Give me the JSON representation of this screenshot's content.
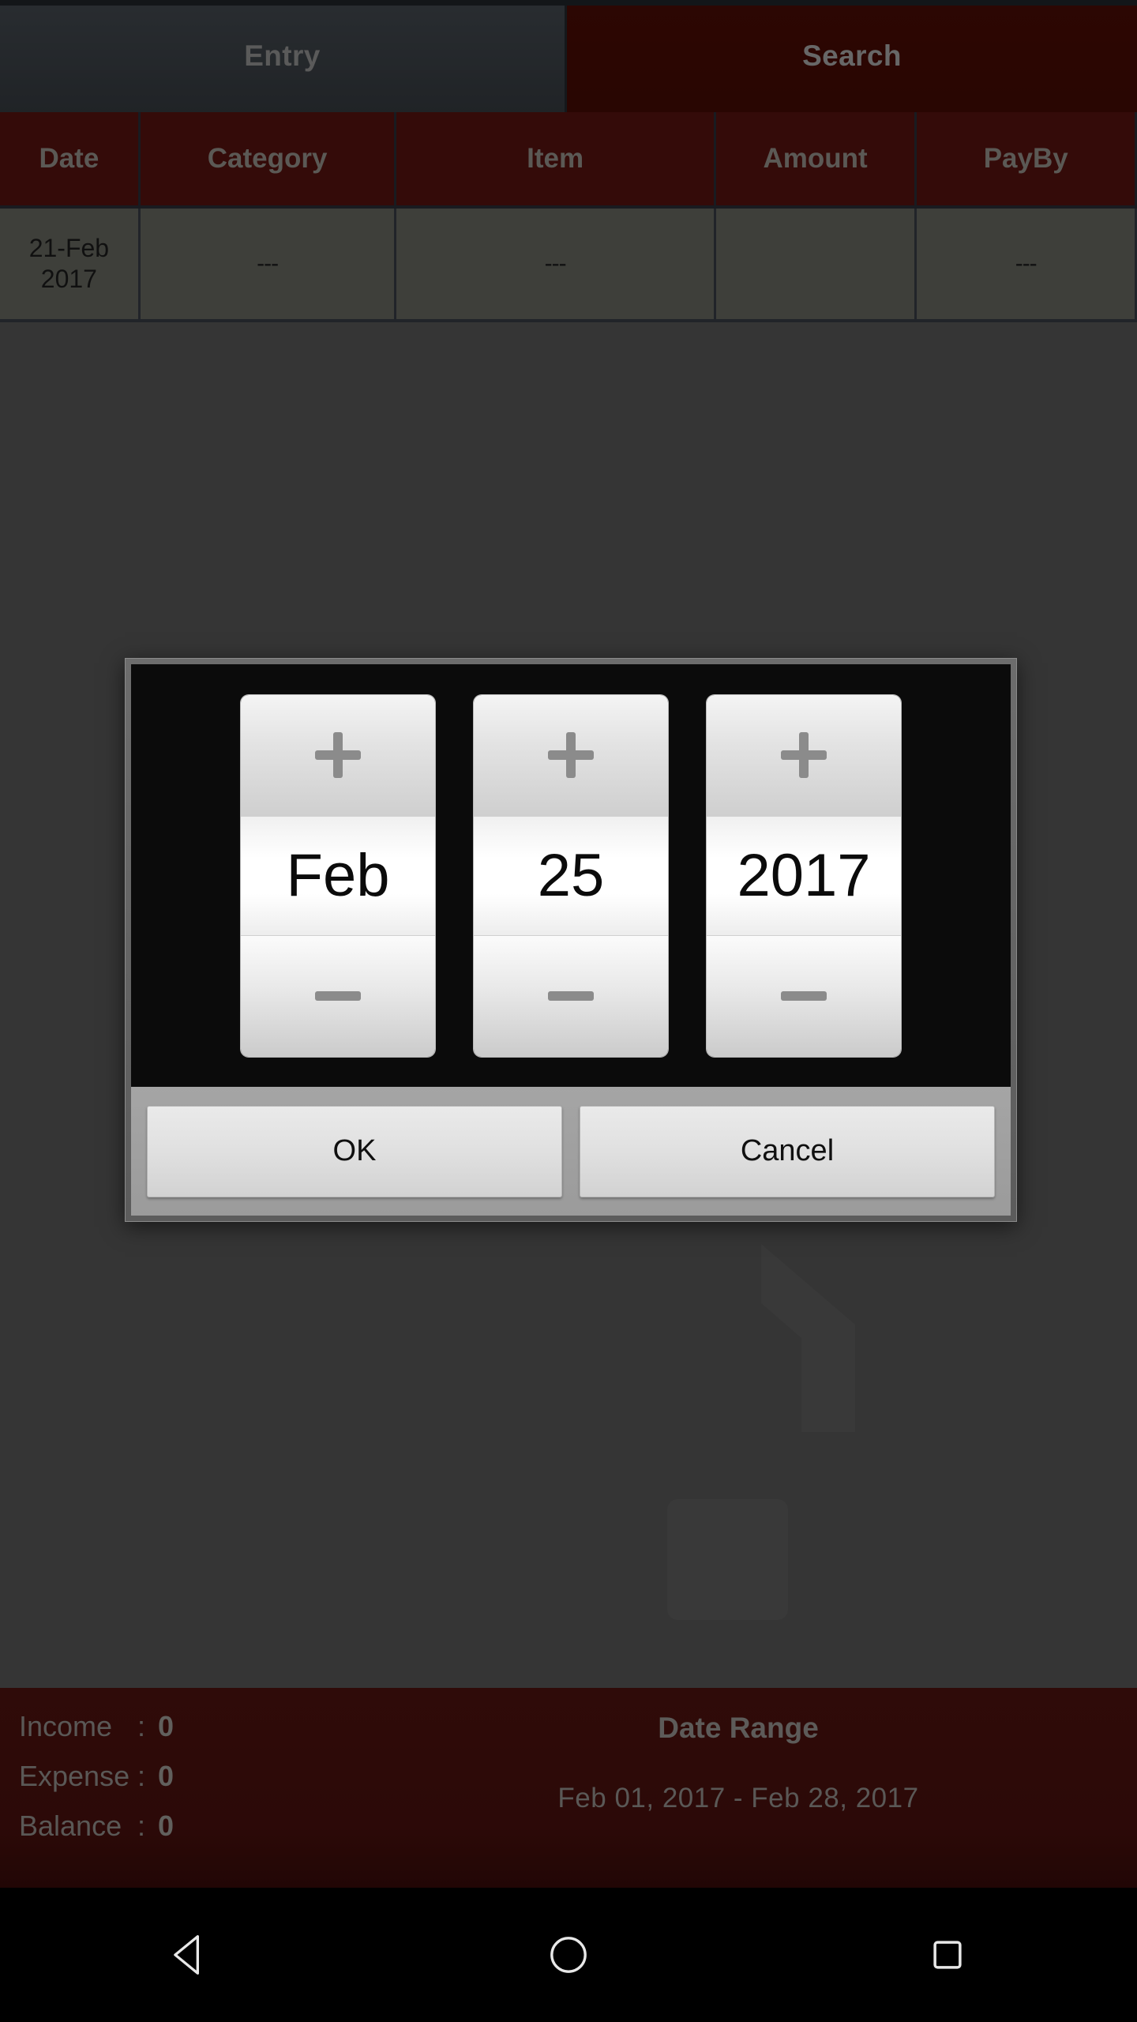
{
  "tabs": [
    {
      "id": "entry",
      "label": "Entry",
      "selected": true
    },
    {
      "id": "search",
      "label": "Search",
      "selected": false
    }
  ],
  "table": {
    "columns": [
      "Date",
      "Category",
      "Item",
      "Amount",
      "PayBy"
    ],
    "rows": [
      {
        "date": "21-Feb\n2017",
        "date_line1": "21-Feb",
        "date_line2": "2017",
        "category": "---",
        "item": "---",
        "amount": "",
        "payby": "---"
      }
    ]
  },
  "summary": {
    "income_label": "Income",
    "income_value": "0",
    "expense_label": "Expense",
    "expense_value": "0",
    "balance_label": "Balance",
    "balance_value": "0",
    "colon": ":",
    "date_range_title": "Date Range",
    "date_range_value": "Feb 01, 2017  -  Feb 28, 2017"
  },
  "dialog": {
    "name": "date-picker-dialog",
    "spinners": [
      {
        "id": "month",
        "value": "Feb",
        "increment": "+",
        "decrement": "–"
      },
      {
        "id": "day",
        "value": "25",
        "increment": "+",
        "decrement": "–"
      },
      {
        "id": "year",
        "value": "2017",
        "increment": "+",
        "decrement": "–"
      }
    ],
    "ok_label": "OK",
    "cancel_label": "Cancel"
  },
  "navbar": {
    "back": "back-triangle",
    "home": "home-circle",
    "recents": "recents-square"
  },
  "colors": {
    "header_red": "#5b1310",
    "tab_active_gray": "#3f454b",
    "tab_inactive_red": "#4a0d05",
    "row_gray": "#6b6d65",
    "dim_background": "#5c5c5c",
    "summary_red": "#4c110e",
    "dialog_black": "#0b0b0b",
    "button_bar_gray": "#9b9b9b"
  }
}
